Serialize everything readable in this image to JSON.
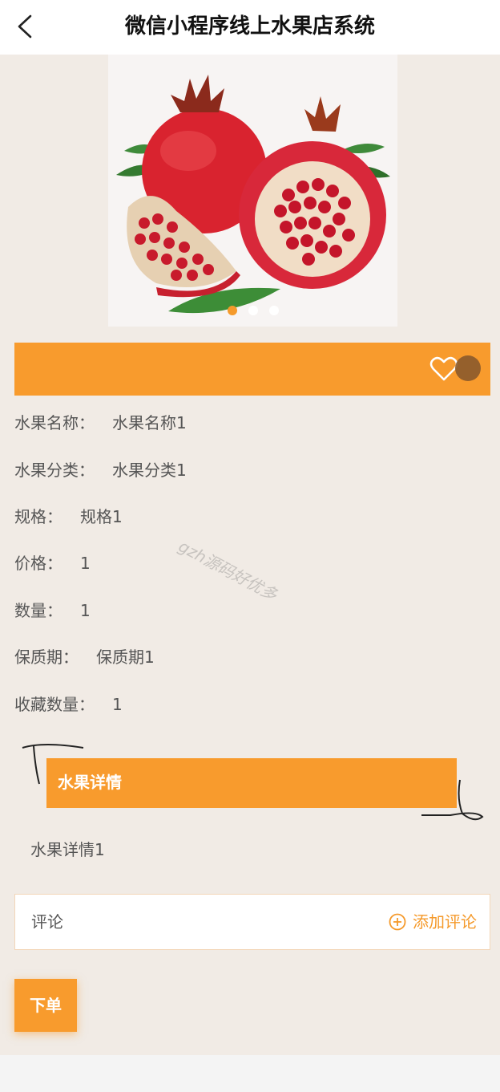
{
  "header": {
    "title": "微信小程序线上水果店系统"
  },
  "carousel": {
    "image_icon": "pomegranate-image",
    "dot_count": 3,
    "active_index": 0
  },
  "fields": [
    {
      "label": "水果名称：",
      "value": "水果名称1"
    },
    {
      "label": "水果分类：",
      "value": "水果分类1"
    },
    {
      "label": "规格：",
      "value": "规格1"
    },
    {
      "label": "价格：",
      "value": "1"
    },
    {
      "label": "数量：",
      "value": "1"
    },
    {
      "label": "保质期：",
      "value": "保质期1"
    },
    {
      "label": "收藏数量：",
      "value": "1"
    }
  ],
  "watermark": "gzh源码好优多",
  "detail": {
    "title": "水果详情",
    "content": "水果详情1"
  },
  "comments": {
    "label": "评论",
    "add_label": "添加评论"
  },
  "order_button": "下单",
  "colors": {
    "accent": "#f89b2d",
    "background": "#f1ebe5"
  }
}
